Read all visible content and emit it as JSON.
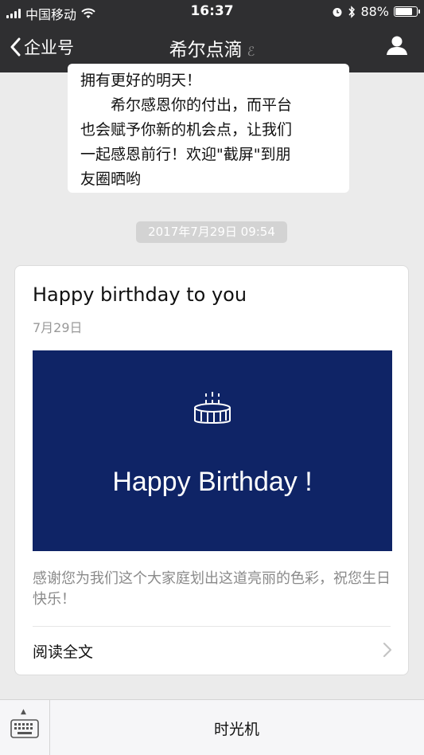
{
  "status": {
    "carrier": "中国移动",
    "time": "16:37",
    "battery": "88%",
    "battery_level": 0.88
  },
  "nav": {
    "back_label": "企业号",
    "title": "希尔点滴",
    "icons": [
      "chevron-left-icon",
      "ear-icon",
      "user-icon"
    ]
  },
  "message": {
    "lines": [
      "拥有更好的明天！",
      "希尔感恩你的付出，而平台",
      "也会赋予你新的机会点，让我们",
      "一起感恩前行！欢迎\"截屏\"到朋",
      "友圈晒哟"
    ]
  },
  "timestamp": "2017年7月29日 09:54",
  "article": {
    "title": "Happy birthday to you",
    "date": "7月29日",
    "cover_text": "Happy Birthday !",
    "cover_color": "#0f2466",
    "description": "感谢您为我们这个大家庭划出这道亮丽的色彩，祝您生日快乐！",
    "read_more": "阅读全文"
  },
  "bottom": {
    "menu_label": "时光机"
  }
}
